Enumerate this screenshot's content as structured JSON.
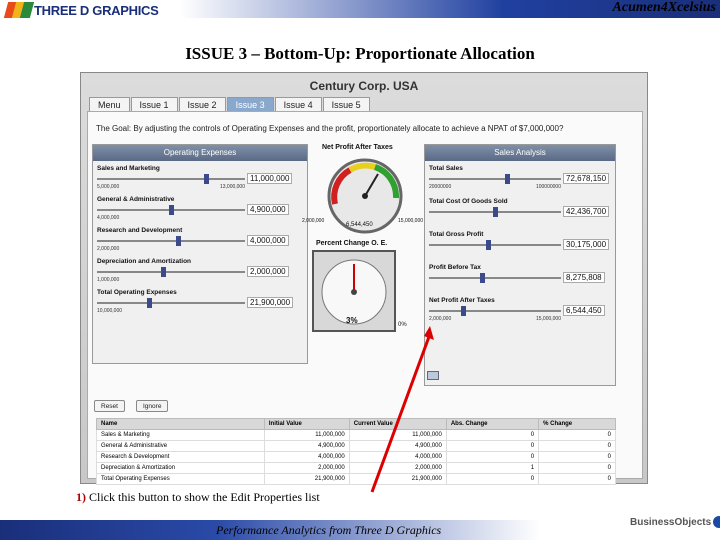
{
  "header": {
    "logo_text": "THREE D GRAPHICS",
    "right_title": "Acumen4Xcelsius"
  },
  "slide_title": "ISSUE 3 – Bottom-Up: Proportionate Allocation",
  "app": {
    "title": "Century Corp. USA",
    "tabs": [
      "Menu",
      "Issue 1",
      "Issue 2",
      "Issue 3",
      "Issue 4",
      "Issue 5"
    ],
    "active_tab": 3,
    "goal": "The Goal: By adjusting the controls of Operating Expenses and the profit, proportionately allocate to achieve a NPAT of $7,000,000?",
    "opex": {
      "title": "Operating Expenses",
      "rows": [
        {
          "label": "Sales and Marketing",
          "min": "5,000,000",
          "max": "13,000,000",
          "value": "11,000,000",
          "position": 0.75
        },
        {
          "label": "General & Administrative",
          "min": "4,000,000",
          "max": "",
          "value": "4,900,000",
          "position": 0.5
        },
        {
          "label": "Research and Development",
          "min": "2,000,000",
          "max": "",
          "value": "4,000,000",
          "position": 0.55
        },
        {
          "label": "Depreciation and Amortization",
          "min": "1,000,000",
          "max": "",
          "value": "2,000,000",
          "position": 0.45
        },
        {
          "label": "Total Operating Expenses",
          "min": "10,000,000",
          "max": "",
          "value": "21,900,000",
          "position": 0.35
        }
      ]
    },
    "gauge1": {
      "title": "Net Profit After Taxes",
      "min": "2,000,000",
      "max": "15,000,000",
      "value": "6,544,450"
    },
    "gauge2": {
      "title": "Percent Change O. E.",
      "value": "3%",
      "right": "0%"
    },
    "sales": {
      "title": "Sales Analysis",
      "rows": [
        {
          "label": "Total Sales",
          "min": "20000000",
          "max": "100000000",
          "value": "72,678,150",
          "position": 0.6
        },
        {
          "label": "Total Cost Of Goods Sold",
          "min": "",
          "max": "",
          "value": "42,436,700",
          "position": 0.5
        },
        {
          "label": "Total Gross Profit",
          "min": "",
          "max": "",
          "value": "30,175,000",
          "position": 0.45
        },
        {
          "label": "Profit Before Tax",
          "min": "",
          "max": "",
          "value": "8,275,808",
          "position": 0.4
        },
        {
          "label": "Net Profit After Taxes",
          "min": "2,000,000",
          "max": "15,000,000",
          "value": "6,544,450",
          "position": 0.25
        }
      ]
    },
    "buttons": {
      "reset": "Reset",
      "ignore": "Ignore"
    },
    "table": {
      "headers": [
        "Name",
        "Initial Value",
        "Current Value",
        "Abs. Change",
        "% Change"
      ],
      "rows": [
        [
          "Sales & Marketing",
          "11,000,000",
          "11,000,000",
          "0",
          "0"
        ],
        [
          "General & Administrative",
          "4,900,000",
          "4,900,000",
          "0",
          "0"
        ],
        [
          "Research & Development",
          "4,000,000",
          "4,000,000",
          "0",
          "0"
        ],
        [
          "Depreciation & Amortization",
          "2,000,000",
          "2,000,000",
          "1",
          "0"
        ],
        [
          "Total Operating Expenses",
          "21,900,000",
          "21,900,000",
          "0",
          "0"
        ]
      ]
    }
  },
  "caption": {
    "number": "1)",
    "text": "Click this button to show the Edit Properties list"
  },
  "footer": {
    "text": "Performance Analytics from Three D Graphics",
    "partner": "BusinessObjects"
  },
  "colors": {
    "accent_red": "#cc0000",
    "brand_blue": "#1a2f7a"
  }
}
